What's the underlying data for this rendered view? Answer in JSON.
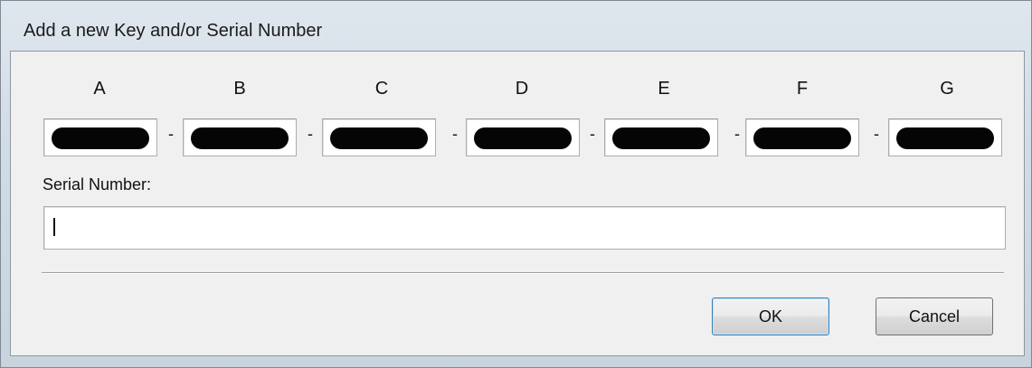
{
  "window": {
    "title": "Add a new Key and/or Serial Number"
  },
  "key": {
    "columns": [
      "A",
      "B",
      "C",
      "D",
      "E",
      "F",
      "G"
    ],
    "separator": "-",
    "fields_redacted": true
  },
  "serial": {
    "label": "Serial Number:",
    "value": ""
  },
  "buttons": {
    "ok": "OK",
    "cancel": "Cancel"
  }
}
